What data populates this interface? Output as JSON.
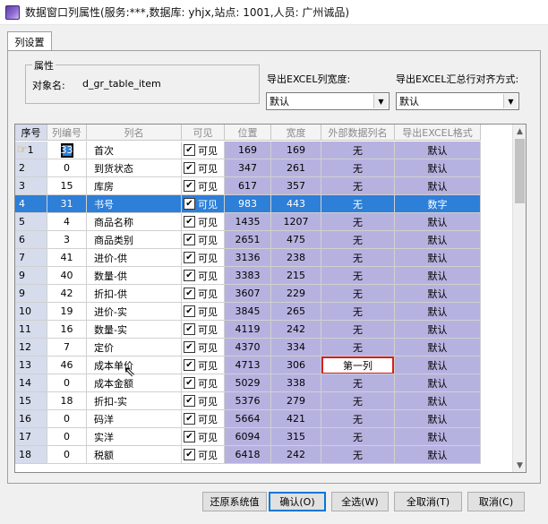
{
  "window": {
    "title": "数据窗口列属性(服务:***,数据库: yhjx,站点: 1001,人员: 广州诚品)"
  },
  "tabs": [
    {
      "label": "列设置"
    }
  ],
  "properties": {
    "group_label": "属性",
    "object_name_label": "对象名:",
    "object_name_value": "d_gr_table_item"
  },
  "export_width": {
    "label": "导出EXCEL列宽度:",
    "value": "默认"
  },
  "export_align": {
    "label": "导出EXCEL汇总行对齐方式:",
    "value": "默认"
  },
  "grid": {
    "headers": [
      "序号",
      "列编号",
      "列名",
      "可见",
      "位置",
      "宽度",
      "外部数据列名",
      "导出EXCEL格式"
    ],
    "rows": [
      {
        "seq": "1",
        "col": "33",
        "name": "首次",
        "vis": "可见",
        "pos": "169",
        "width": "169",
        "ext": "无",
        "fmt": "默认"
      },
      {
        "seq": "2",
        "col": "0",
        "name": "到货状态",
        "vis": "可见",
        "pos": "347",
        "width": "261",
        "ext": "无",
        "fmt": "默认"
      },
      {
        "seq": "3",
        "col": "15",
        "name": "库房",
        "vis": "可见",
        "pos": "617",
        "width": "357",
        "ext": "无",
        "fmt": "默认"
      },
      {
        "seq": "4",
        "col": "31",
        "name": "书号",
        "vis": "可见",
        "pos": "983",
        "width": "443",
        "ext": "无",
        "fmt": "数字"
      },
      {
        "seq": "5",
        "col": "4",
        "name": "商品名称",
        "vis": "可见",
        "pos": "1435",
        "width": "1207",
        "ext": "无",
        "fmt": "默认"
      },
      {
        "seq": "6",
        "col": "3",
        "name": "商品类别",
        "vis": "可见",
        "pos": "2651",
        "width": "475",
        "ext": "无",
        "fmt": "默认"
      },
      {
        "seq": "7",
        "col": "41",
        "name": "进价-供",
        "vis": "可见",
        "pos": "3136",
        "width": "238",
        "ext": "无",
        "fmt": "默认"
      },
      {
        "seq": "9",
        "col": "40",
        "name": "数量-供",
        "vis": "可见",
        "pos": "3383",
        "width": "215",
        "ext": "无",
        "fmt": "默认"
      },
      {
        "seq": "9",
        "col": "42",
        "name": "折扣-供",
        "vis": "可见",
        "pos": "3607",
        "width": "229",
        "ext": "无",
        "fmt": "默认"
      },
      {
        "seq": "10",
        "col": "19",
        "name": "进价-实",
        "vis": "可见",
        "pos": "3845",
        "width": "265",
        "ext": "无",
        "fmt": "默认"
      },
      {
        "seq": "11",
        "col": "16",
        "name": "数量-实",
        "vis": "可见",
        "pos": "4119",
        "width": "242",
        "ext": "无",
        "fmt": "默认"
      },
      {
        "seq": "12",
        "col": "7",
        "name": "定价",
        "vis": "可见",
        "pos": "4370",
        "width": "334",
        "ext": "无",
        "fmt": "默认"
      },
      {
        "seq": "13",
        "col": "46",
        "name": "成本单价",
        "vis": "可见",
        "pos": "4713",
        "width": "306",
        "ext": "第一列",
        "fmt": "默认"
      },
      {
        "seq": "14",
        "col": "0",
        "name": "成本金额",
        "vis": "可见",
        "pos": "5029",
        "width": "338",
        "ext": "无",
        "fmt": "默认"
      },
      {
        "seq": "15",
        "col": "18",
        "name": "折扣-实",
        "vis": "可见",
        "pos": "5376",
        "width": "279",
        "ext": "无",
        "fmt": "默认"
      },
      {
        "seq": "16",
        "col": "0",
        "name": "码洋",
        "vis": "可见",
        "pos": "5664",
        "width": "421",
        "ext": "无",
        "fmt": "默认"
      },
      {
        "seq": "17",
        "col": "0",
        "name": "实洋",
        "vis": "可见",
        "pos": "6094",
        "width": "315",
        "ext": "无",
        "fmt": "默认"
      },
      {
        "seq": "18",
        "col": "0",
        "name": "税额",
        "vis": "可见",
        "pos": "6418",
        "width": "242",
        "ext": "无",
        "fmt": "默认"
      }
    ]
  },
  "buttons": {
    "restore": "还原系统值",
    "ok": "确认(O)",
    "select_all": "全选(W)",
    "deselect_all": "全取消(T)",
    "cancel": "取消(C)"
  }
}
